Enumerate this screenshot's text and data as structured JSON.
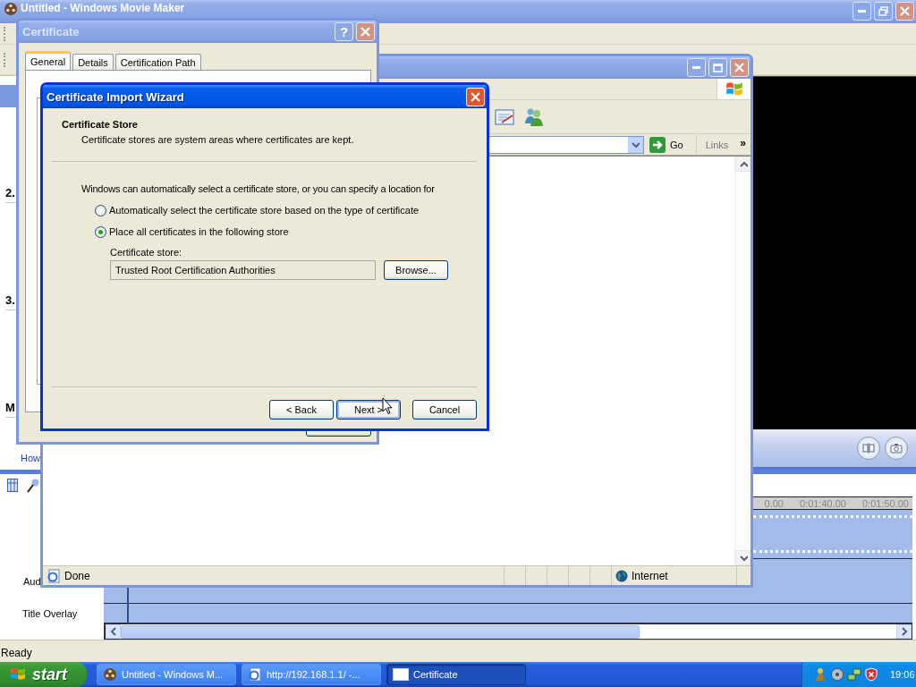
{
  "movie_maker": {
    "title": "Untitled - Windows Movie Maker",
    "task_pane": {
      "sections": [
        "2.",
        "3.",
        "M"
      ],
      "links": [
        "How"
      ]
    },
    "timeline": {
      "ruler": [
        "0.00",
        "0:01:40.00",
        "0:01:50.00"
      ],
      "tracks": [
        {
          "kind": "video"
        },
        {
          "kind": "audio",
          "label": "Aud"
        },
        {
          "kind": "title",
          "label": "Title Overlay"
        }
      ]
    },
    "status": "Ready"
  },
  "certificate_dialog": {
    "title": "Certificate",
    "help": "?",
    "tabs": [
      {
        "label": "General",
        "selected": true
      },
      {
        "label": "Details",
        "selected": false
      },
      {
        "label": "Certification Path",
        "selected": false
      }
    ]
  },
  "browser": {
    "go": "Go",
    "links": "Links",
    "more": "»",
    "status": "Done",
    "zone": "Internet"
  },
  "wizard": {
    "title": "Certificate Import Wizard",
    "heading": "Certificate Store",
    "subheading": "Certificate stores are system areas where certificates are kept.",
    "intro": "Windows can automatically select a certificate store, or you can specify a location for",
    "options": [
      {
        "label": "Automatically select the certificate store based on the type of certificate",
        "selected": false
      },
      {
        "label": "Place all certificates in the following store",
        "selected": true
      }
    ],
    "store_label": "Certificate store:",
    "store_value": "Trusted Root Certification Authorities",
    "browse": "Browse...",
    "buttons": [
      "< Back",
      "Next >",
      "Cancel"
    ]
  },
  "taskbar": {
    "start": "start",
    "tasks": [
      {
        "label": "Untitled - Windows M...",
        "selected": false
      },
      {
        "label": "http://192.168.1.1/ -...",
        "selected": false
      },
      {
        "label": "Certificate",
        "selected": true
      }
    ],
    "clock": "19:06"
  }
}
